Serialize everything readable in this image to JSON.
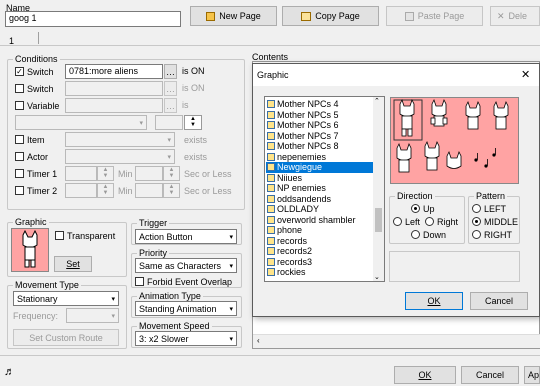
{
  "name": {
    "label": "Name",
    "value": "goog 1"
  },
  "toolbar": {
    "new_page": "New Page",
    "copy_page": "Copy Page",
    "paste_page": "Paste Page",
    "delete": "Dele"
  },
  "page_tab": "1",
  "conditions": {
    "title": "Conditions",
    "switch1": {
      "label": "Switch",
      "value": "0781:more aliens",
      "suffix": "is ON",
      "checked": true
    },
    "switch2": {
      "label": "Switch",
      "value": "",
      "suffix": "is ON"
    },
    "variable": {
      "label": "Variable",
      "value": "",
      "suffix": "is"
    },
    "item": {
      "label": "Item",
      "suffix": "exists"
    },
    "actor": {
      "label": "Actor",
      "suffix": "exists"
    },
    "timer1": {
      "label": "Timer 1",
      "min": "Min",
      "sec": "Sec or Less"
    },
    "timer2": {
      "label": "Timer 2",
      "min": "Min",
      "sec": "Sec or Less"
    }
  },
  "graphic": {
    "title": "Graphic",
    "transparent": "Transparent",
    "set": "Set"
  },
  "trigger": {
    "title": "Trigger",
    "value": "Action Button"
  },
  "priority": {
    "title": "Priority",
    "value": "Same as Characters",
    "forbid": "Forbid Event Overlap"
  },
  "movement": {
    "title": "Movement Type",
    "value": "Stationary",
    "frequency": "Frequency:",
    "custom": "Set Custom Route"
  },
  "animation": {
    "title": "Animation Type",
    "value": "Standing Animation"
  },
  "speed": {
    "title": "Movement Speed",
    "value": "3: x2 Slower"
  },
  "contents": {
    "title": "Contents"
  },
  "dialog": {
    "title": "Graphic",
    "close": "✕",
    "files": [
      "Mother NPCs 4",
      "Mother NPCs 5",
      "Mother NPCs 6",
      "Mother NPCs 7",
      "Mother NPCs 8",
      "nepenemies",
      "Newgiegue",
      "Niiues",
      "NP enemies",
      "oddsandends",
      "OLDLADY",
      "overworld shambler",
      "phone",
      "records",
      "records2",
      "records3",
      "rockies"
    ],
    "selected_index": 6,
    "direction": {
      "title": "Direction",
      "up": "Up",
      "left": "Left",
      "right": "Right",
      "down": "Down"
    },
    "pattern": {
      "title": "Pattern",
      "left": "LEFT",
      "middle": "MIDDLE",
      "right": "RIGHT"
    },
    "ok": "OK",
    "cancel": "Cancel"
  },
  "footer": {
    "ok": "OK",
    "cancel": "Cancel",
    "apply": "Ap"
  },
  "colors": {
    "sprite_bg": "#ffa3a3",
    "selection": "#0078d7"
  }
}
